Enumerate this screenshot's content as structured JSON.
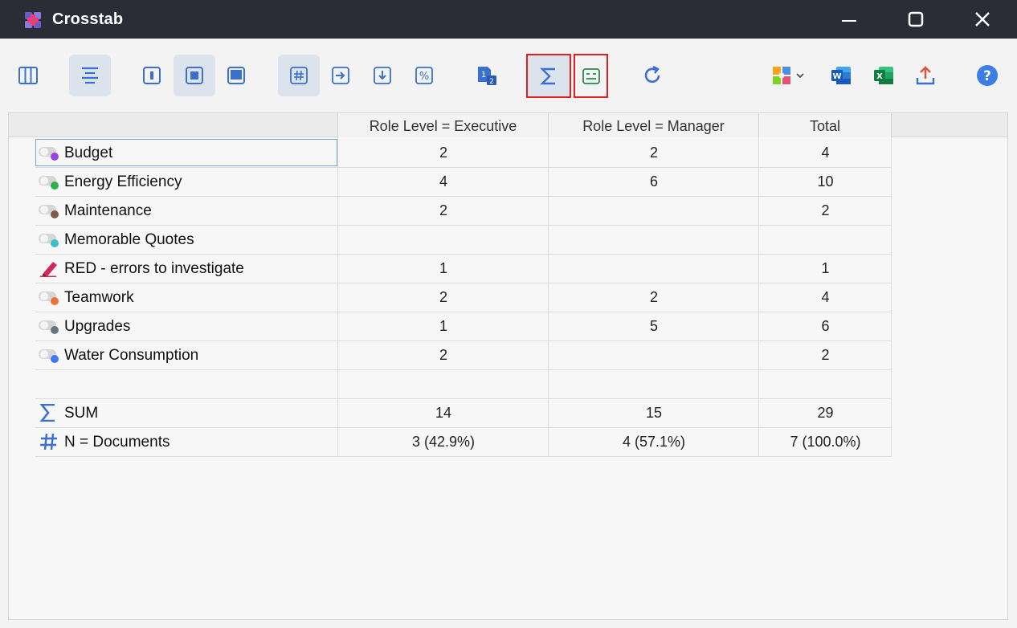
{
  "window": {
    "title": "Crosstab"
  },
  "toolbar": {
    "buttons": [
      {
        "name": "columns-view-button",
        "icon": "columns-icon"
      },
      {
        "name": "align-center-button",
        "icon": "align-center-icon",
        "active": true
      },
      {
        "name": "frame-small-button",
        "icon": "frame-small-icon"
      },
      {
        "name": "frame-medium-button",
        "icon": "frame-medium-icon",
        "active": true
      },
      {
        "name": "frame-large-button",
        "icon": "frame-large-icon"
      },
      {
        "name": "count-button",
        "icon": "hash-icon",
        "active": true
      },
      {
        "name": "row-percent-button",
        "icon": "arrow-right-box-icon"
      },
      {
        "name": "column-percent-button",
        "icon": "arrow-down-box-icon"
      },
      {
        "name": "percent-button",
        "icon": "percent-icon"
      },
      {
        "name": "numbering-button",
        "icon": "number-12-icon"
      },
      {
        "name": "sum-button",
        "icon": "sigma-icon",
        "active": true
      },
      {
        "name": "totals-row-button",
        "icon": "table-minus-icon"
      },
      {
        "name": "refresh-button",
        "icon": "refresh-icon"
      },
      {
        "name": "color-scheme-button",
        "icon": "puzzle-icon"
      },
      {
        "name": "export-word-button",
        "icon": "word-icon"
      },
      {
        "name": "export-excel-button",
        "icon": "excel-icon"
      },
      {
        "name": "export-button",
        "icon": "upload-icon"
      },
      {
        "name": "help-button",
        "icon": "help-icon"
      }
    ]
  },
  "table": {
    "columns": [
      "Role Level = Executive",
      "Role Level = Manager",
      "Total"
    ],
    "rows": [
      {
        "label": "Budget",
        "dot_color": "#9b44e0",
        "values": [
          "2",
          "2",
          "4"
        ]
      },
      {
        "label": "Energy Efficiency",
        "dot_color": "#2fb24a",
        "values": [
          "4",
          "6",
          "10"
        ]
      },
      {
        "label": "Maintenance",
        "dot_color": "#7d5a4a",
        "values": [
          "2",
          "",
          "2"
        ]
      },
      {
        "label": "Memorable Quotes",
        "dot_color": "#3bbfd0",
        "values": [
          "",
          "",
          ""
        ]
      },
      {
        "label": "RED - errors to investigate",
        "icon": "marker-icon",
        "dot_color": "#d02a5a",
        "values": [
          "1",
          "",
          "1"
        ]
      },
      {
        "label": "Teamwork",
        "dot_color": "#f0703a",
        "values": [
          "2",
          "2",
          "4"
        ]
      },
      {
        "label": "Upgrades",
        "dot_color": "#6b7480",
        "values": [
          "1",
          "5",
          "6"
        ]
      },
      {
        "label": "Water Consumption",
        "dot_color": "#3a7cf0",
        "values": [
          "2",
          "",
          "2"
        ]
      }
    ],
    "sum_row": {
      "label": "SUM",
      "values": [
        "14",
        "15",
        "29"
      ]
    },
    "n_row": {
      "label": "N = Documents",
      "values": [
        "3 (42.9%)",
        "4 (57.1%)",
        "7 (100.0%)"
      ]
    }
  },
  "colors": {
    "accent": "#4a7fd6",
    "highlight": "#e02020",
    "titlebar": "#2b2d36"
  }
}
